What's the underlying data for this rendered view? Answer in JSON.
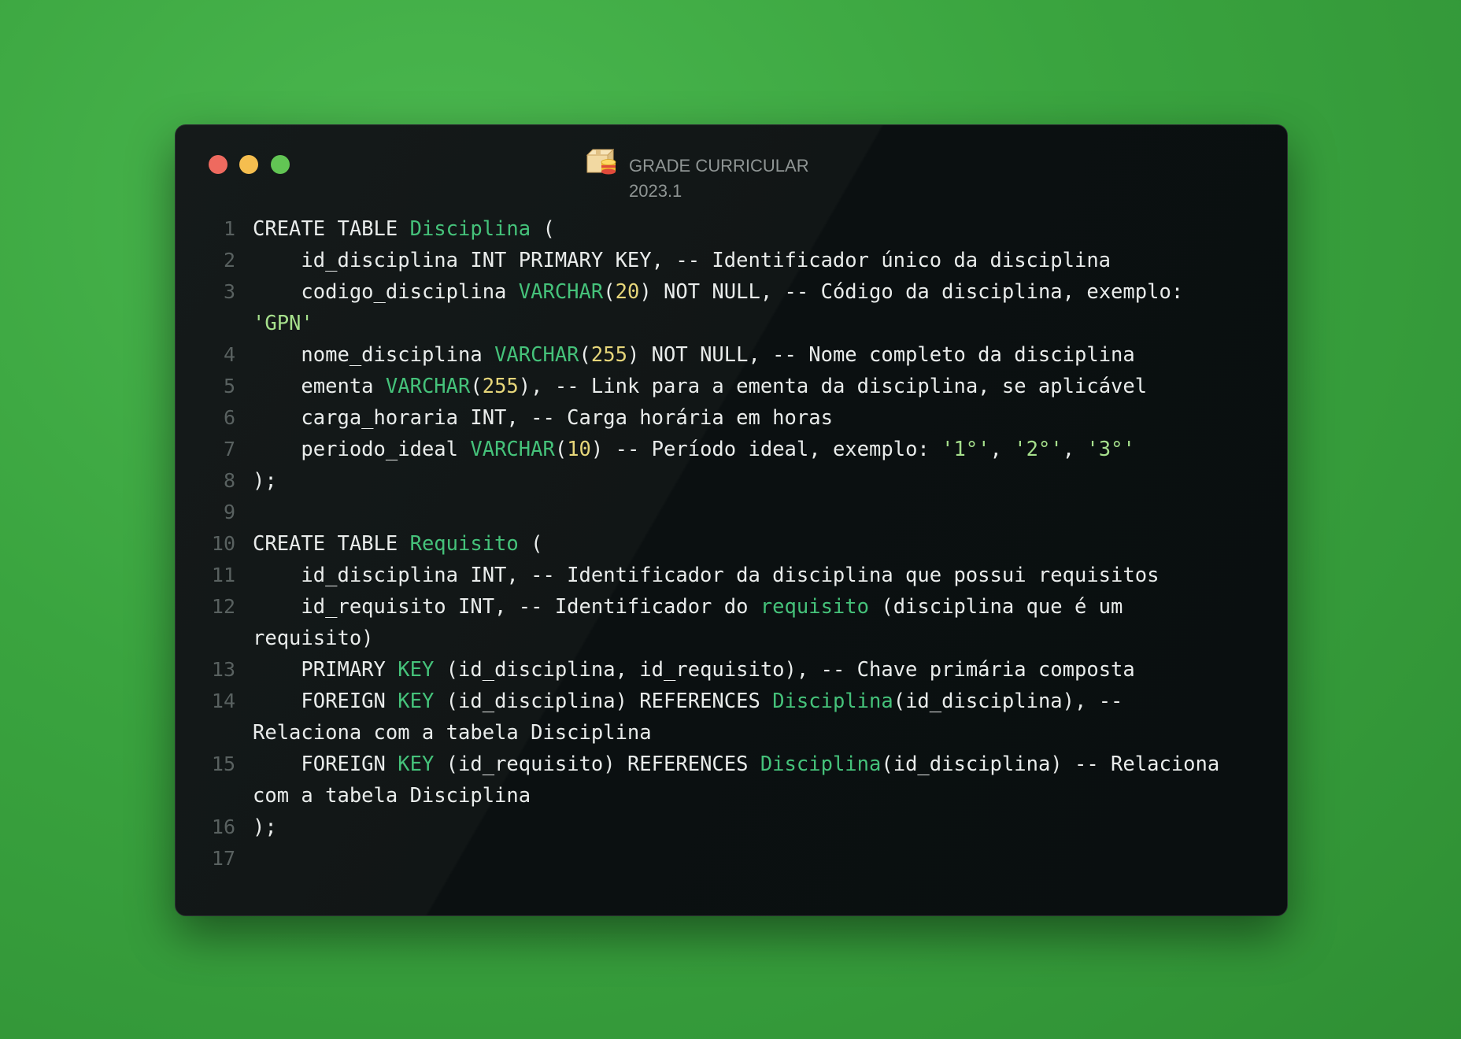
{
  "window": {
    "title": "GRADE CURRICULAR",
    "subtitle": "2023.1",
    "title_icon": "box-database-icon",
    "controls": [
      "close",
      "minimize",
      "maximize"
    ]
  },
  "colors": {
    "background": "#3aa43f",
    "window": "#0f1414",
    "text": "#e9eceb",
    "keyword_green": "#45c27a",
    "number_yellow": "#e6d67a",
    "string_green": "#a6e08c",
    "line_number": "#596160"
  },
  "code": {
    "lines": [
      [
        {
          "t": "CREATE TABLE "
        },
        {
          "t": "Disciplina",
          "c": "g"
        },
        {
          "t": " ("
        }
      ],
      [
        {
          "t": "    id_disciplina INT PRIMARY KEY, -- Identificador único da disciplina"
        }
      ],
      [
        {
          "t": "    codigo_disciplina "
        },
        {
          "t": "VARCHAR",
          "c": "g"
        },
        {
          "t": "("
        },
        {
          "t": "20",
          "c": "y"
        },
        {
          "t": ") NOT NULL, -- Código da disciplina, exemplo:\n"
        },
        {
          "t": "'GPN'",
          "c": "s"
        }
      ],
      [
        {
          "t": "    nome_disciplina "
        },
        {
          "t": "VARCHAR",
          "c": "g"
        },
        {
          "t": "("
        },
        {
          "t": "255",
          "c": "y"
        },
        {
          "t": ") NOT NULL, -- Nome completo da disciplina"
        }
      ],
      [
        {
          "t": "    ementa "
        },
        {
          "t": "VARCHAR",
          "c": "g"
        },
        {
          "t": "("
        },
        {
          "t": "255",
          "c": "y"
        },
        {
          "t": "), -- Link para a ementa da disciplina, se aplicável"
        }
      ],
      [
        {
          "t": "    carga_horaria INT, -- Carga horária em horas"
        }
      ],
      [
        {
          "t": "    periodo_ideal "
        },
        {
          "t": "VARCHAR",
          "c": "g"
        },
        {
          "t": "("
        },
        {
          "t": "10",
          "c": "y"
        },
        {
          "t": ") -- Período ideal, exemplo: "
        },
        {
          "t": "'1°'",
          "c": "s"
        },
        {
          "t": ", "
        },
        {
          "t": "'2°'",
          "c": "s"
        },
        {
          "t": ", "
        },
        {
          "t": "'3°'",
          "c": "s"
        }
      ],
      [
        {
          "t": ");"
        }
      ],
      [
        {
          "t": ""
        }
      ],
      [
        {
          "t": "CREATE TABLE "
        },
        {
          "t": "Requisito",
          "c": "g"
        },
        {
          "t": " ("
        }
      ],
      [
        {
          "t": "    id_disciplina INT, -- Identificador da disciplina que possui requisitos"
        }
      ],
      [
        {
          "t": "    id_requisito INT, -- Identificador do "
        },
        {
          "t": "requisito",
          "c": "g"
        },
        {
          "t": " (disciplina que é um\nrequisito)"
        }
      ],
      [
        {
          "t": "    PRIMARY "
        },
        {
          "t": "KEY",
          "c": "g"
        },
        {
          "t": " (id_disciplina, id_requisito), -- Chave primária composta"
        }
      ],
      [
        {
          "t": "    FOREIGN "
        },
        {
          "t": "KEY",
          "c": "g"
        },
        {
          "t": " (id_disciplina) REFERENCES "
        },
        {
          "t": "Disciplina",
          "c": "g"
        },
        {
          "t": "(id_disciplina), --\nRelaciona com a tabela Disciplina"
        }
      ],
      [
        {
          "t": "    FOREIGN "
        },
        {
          "t": "KEY",
          "c": "g"
        },
        {
          "t": " (id_requisito) REFERENCES "
        },
        {
          "t": "Disciplina",
          "c": "g"
        },
        {
          "t": "(id_disciplina) -- Relaciona\ncom a tabela Disciplina"
        }
      ],
      [
        {
          "t": ");"
        }
      ],
      [
        {
          "t": ""
        }
      ]
    ]
  }
}
